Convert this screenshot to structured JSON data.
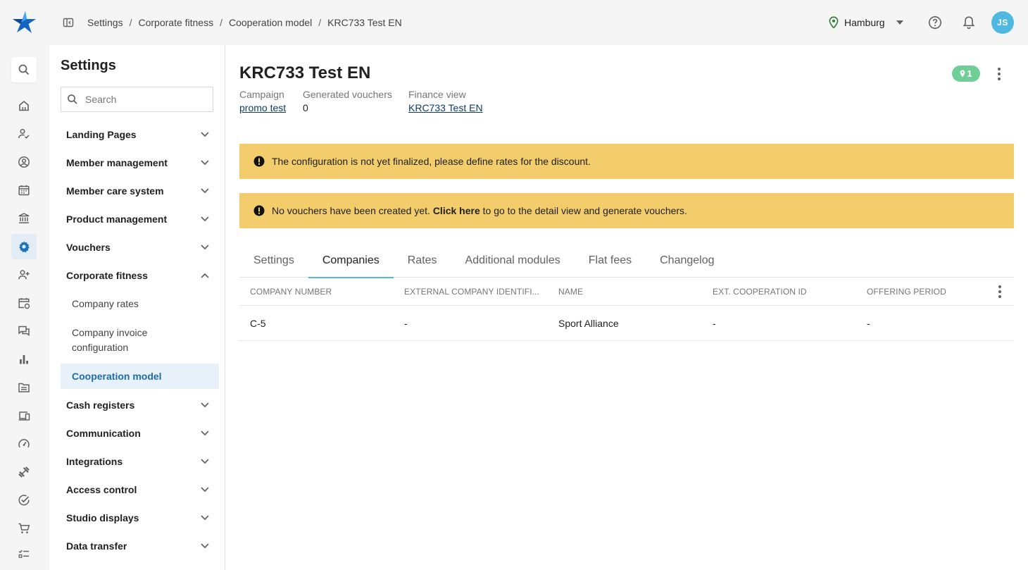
{
  "breadcrumb": [
    "Settings",
    "Corporate fitness",
    "Cooperation model",
    "KRC733 Test EN"
  ],
  "location": "Hamburg",
  "user_initials": "JS",
  "accent_color": "#4fb8e0",
  "rail_icons": [
    "search-icon",
    "home-icon",
    "member-check-icon",
    "account-circle-icon",
    "calendar-icon",
    "bank-icon",
    "settings-icon",
    "add-user-icon",
    "calendar-sync-icon",
    "chat-icon",
    "bar-chart-icon",
    "folder-icon",
    "devices-icon",
    "gauge-icon",
    "dumbbell-icon",
    "check-circle-icon",
    "cart-icon",
    "tasks-icon"
  ],
  "settings": {
    "title": "Settings",
    "search_placeholder": "Search",
    "items": [
      {
        "label": "Landing Pages"
      },
      {
        "label": "Member management"
      },
      {
        "label": "Member care system"
      },
      {
        "label": "Product management"
      },
      {
        "label": "Vouchers"
      },
      {
        "label": "Corporate fitness"
      },
      {
        "label": "Cash registers"
      },
      {
        "label": "Communication"
      },
      {
        "label": "Integrations"
      },
      {
        "label": "Access control"
      },
      {
        "label": "Studio displays"
      },
      {
        "label": "Data transfer"
      }
    ],
    "subitems": [
      {
        "label": "Company rates"
      },
      {
        "label": "Company invoice configuration"
      },
      {
        "label": "Cooperation model"
      }
    ]
  },
  "page": {
    "title": "KRC733 Test EN",
    "badge_count": "1",
    "meta": {
      "campaign_label": "Campaign",
      "campaign_value": "promo test",
      "generated_label": "Generated vouchers",
      "generated_value": "0",
      "finance_label": "Finance view",
      "finance_value": "KRC733 Test EN"
    },
    "alert1": "The configuration is not yet finalized, please define rates for the discount.",
    "alert2_before": "No vouchers have been created yet.",
    "alert2_link": "Click here",
    "alert2_after": "to go to the detail view and generate vouchers.",
    "alert_color": "#f3cd6c"
  },
  "tabs": [
    "Settings",
    "Companies",
    "Rates",
    "Additional modules",
    "Flat fees",
    "Changelog"
  ],
  "table": {
    "headers": [
      "Company number",
      "External company identifi...",
      "Name",
      "Ext. cooperation ID",
      "Offering period"
    ],
    "rows": [
      [
        "C-5",
        "-",
        "Sport Alliance",
        "-",
        "-"
      ]
    ]
  }
}
